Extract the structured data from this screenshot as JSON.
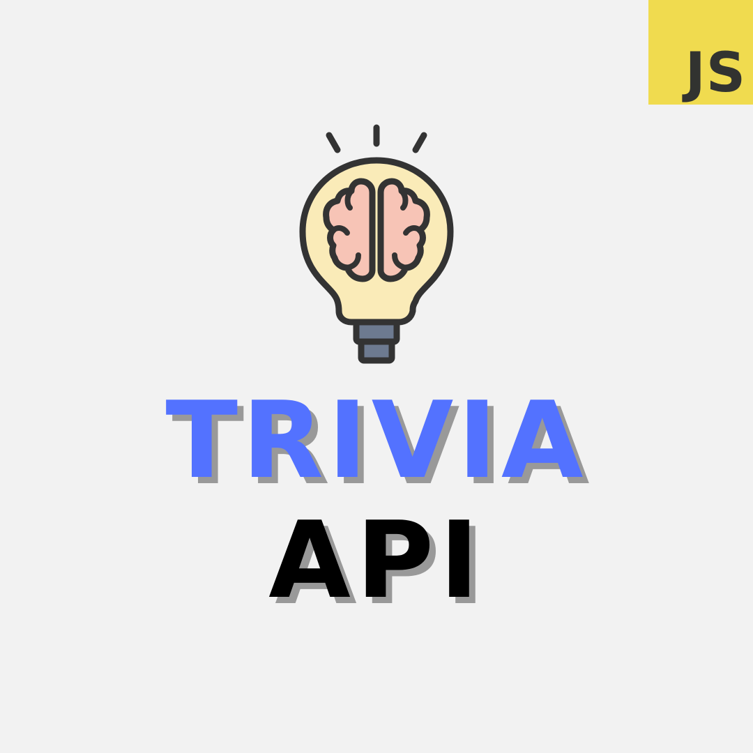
{
  "badge": {
    "label": "JS",
    "background": "#f0db4f",
    "text_color": "#323330"
  },
  "logo": {
    "icon": "lightbulb-brain-icon",
    "bulb_color": "#faebb8",
    "brain_color": "#f7c4b6",
    "base_color": "#6d7a90",
    "outline_color": "#333333"
  },
  "title": {
    "line1": "TRIVIA",
    "line1_color": "#5372ff",
    "line2": "API",
    "line2_color": "#000000",
    "shadow_color": "#999999"
  },
  "background": "#f2f2f2"
}
